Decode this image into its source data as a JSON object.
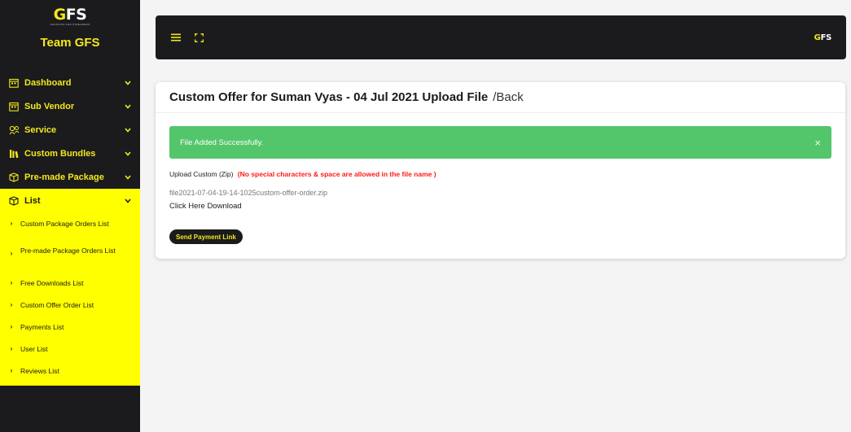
{
  "sidebar": {
    "logo_text": "GFS",
    "logo_sub": "GRAPHICS FOR STREAMERS",
    "brand_title": "Team GFS",
    "menu": [
      {
        "label": "Dashboard",
        "icon": "calendar-icon"
      },
      {
        "label": "Sub Vendor",
        "icon": "calendar-icon"
      },
      {
        "label": "Service",
        "icon": "service-icon"
      },
      {
        "label": "Custom Bundles",
        "icon": "bundle-icon"
      },
      {
        "label": "Pre-made Package",
        "icon": "package-icon"
      },
      {
        "label": "List",
        "icon": "list-icon",
        "active": true
      }
    ],
    "submenu": [
      {
        "label": "Custom Package Orders List"
      },
      {
        "label": "Pre-made Package Orders List"
      },
      {
        "label": "Free Downloads List"
      },
      {
        "label": "Custom Offer Order List"
      },
      {
        "label": "Payments List"
      },
      {
        "label": "User List"
      },
      {
        "label": "Reviews List"
      }
    ]
  },
  "topbar": {
    "menu_icon": "hamburger-icon",
    "fullscreen_icon": "fullscreen-icon",
    "logo_text": "GFS"
  },
  "card": {
    "title": "Custom Offer for Suman Vyas - 04 Jul 2021 Upload File",
    "back_label": "/Back",
    "alert_text": "File Added Successfully.",
    "alert_close": "×",
    "upload_label": "Upload Custom (Zip)",
    "upload_warning": "(No special characters & space are allowed in the file name )",
    "file_name": "file2021-07-04-19-14-1025custom-offer-order.zip",
    "download_label": "Click Here Download",
    "send_payment_label": "Send Payment Link"
  },
  "colors": {
    "sidebar_bg": "#1b1b1d",
    "accent_yellow": "#ffff00",
    "brand_yellow": "#f2e81e",
    "success_green": "#53c66b",
    "warning_red": "#ff1a1a"
  }
}
